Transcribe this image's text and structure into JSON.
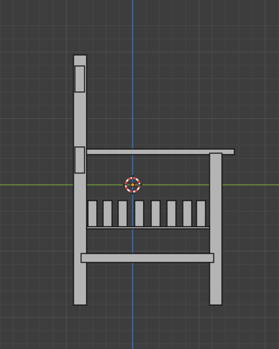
{
  "viewport": {
    "view": "side-orthographic",
    "object": "chair",
    "colors": {
      "background": "#3d3d3d",
      "grid_minor": "#474747",
      "grid_major": "#4f4f4f",
      "axis_vertical": "#4a78c0",
      "axis_horizontal": "#7aa23a",
      "mesh_fill": "#b4b4b4",
      "mesh_edge": "#0e0e0e",
      "cursor_red": "#e03a3a",
      "cursor_white": "#f4f4f4",
      "origin_dot": "#ff9a1a"
    },
    "icons": [
      "3d-cursor-icon",
      "object-origin-icon"
    ]
  }
}
